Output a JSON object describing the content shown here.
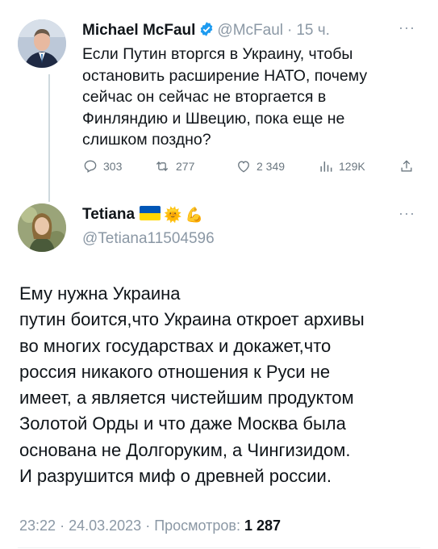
{
  "tweet1": {
    "name": "Michael McFaul",
    "handle": "@McFaul",
    "separator": "·",
    "time": "15 ч.",
    "more": "···",
    "text_lines": [
      "Если Путин вторгся в Украину, чтобы",
      "остановить расширение НАТО, почему",
      "сейчас он сейчас не вторгается в",
      "Финляндию и Швецию, пока еще не",
      "слишком поздно?"
    ],
    "stats": {
      "replies": "303",
      "retweets": "277",
      "likes": "2 349",
      "views": "129K"
    }
  },
  "tweet2": {
    "name": "Tetiana",
    "badges": [
      "ukraine-flag",
      "sun-emoji",
      "flexed-biceps-emoji"
    ],
    "sun": "🌞",
    "biceps": "💪",
    "handle": "@Tetiana11504596",
    "more": "···",
    "text_lines": [
      "Ему нужна Украина",
      "путин боится,что Украина откроет архивы",
      "во многих государствах и докажет,что",
      "россия никакого отношения к Руси не",
      "имеет, а является чистейшим продуктом",
      "Золотой Орды и что даже Москва была",
      "основана не Долгоруким, а Чингизидом.",
      "И разрушится миф о древней россии."
    ],
    "time": "23:22",
    "date": "24.03.2023",
    "views_label": "Просмотров:",
    "views_count": "1 287",
    "dot": "·"
  },
  "colors": {
    "verified_blue": "#1d9bf0",
    "secondary_text": "#8b98a5",
    "thread_line": "#cfd9de",
    "flag_blue": "#0057b7",
    "flag_yellow": "#ffd700"
  }
}
